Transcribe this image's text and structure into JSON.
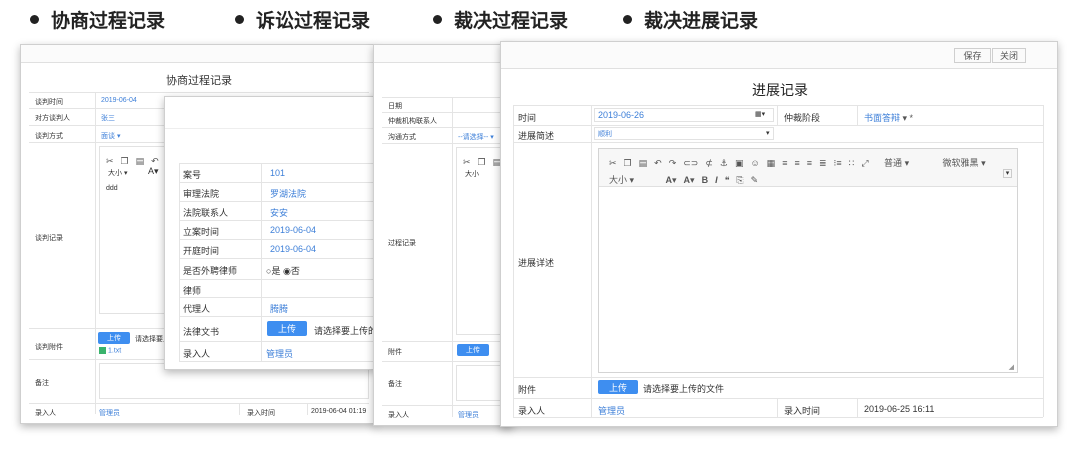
{
  "headings": [
    "协商过程记录",
    "诉讼过程记录",
    "裁决过程记录",
    "裁决进展记录"
  ],
  "consult": {
    "title": "协商过程记录",
    "time_label": "谈判时间",
    "time_value": "2019-06-04",
    "opponent_label": "对方谈判人",
    "opponent_value": "张三",
    "method_label": "谈判方式",
    "method_value": "面谈",
    "record_label": "谈判记录",
    "record_text": "ddd",
    "font_size_label": "大小",
    "attach_label": "谈判附件",
    "upload_label": "上传",
    "upload_hint": "请选择要上",
    "file_name": "1.txt",
    "note_label": "备注",
    "recorder_label": "录入人",
    "recorder_value": "管理员",
    "rec_time_label": "录入时间",
    "rec_time_value": "2019-06-04 01:19"
  },
  "litigation": {
    "case_no_label": "案号",
    "case_no_value": "101",
    "court_label": "审理法院",
    "court_value": "罗湖法院",
    "contact_label": "法院联系人",
    "contact_value": "安安",
    "file_time_label": "立案时间",
    "file_time_value": "2019-06-04",
    "open_time_label": "开庭时间",
    "open_time_value": "2019-06-04",
    "lawyer_q_label": "是否外聘律师",
    "opt_yes": "是",
    "opt_no": "否",
    "lawyer_label": "律师",
    "lawyer_value": "",
    "agent_label": "代理人",
    "agent_value": "腾腾",
    "doc_label": "法律文书",
    "upload_label": "上传",
    "upload_hint": "请选择要上传的文",
    "recorder_label": "录入人",
    "recorder_value": "管理员"
  },
  "arbitration": {
    "date_label": "日期",
    "contact_label": "仲裁机构联系人",
    "comm_label": "沟通方式",
    "comm_value": "--请选择-- ▾",
    "font_size_label": "大小",
    "process_label": "过程记录",
    "attach_label": "附件",
    "upload_label": "上传",
    "note_label": "备注",
    "recorder_label": "录入人",
    "recorder_value": "管理员"
  },
  "progress": {
    "save_label": "保存",
    "close_label": "关闭",
    "title": "进展记录",
    "time_label": "时间",
    "time_value": "2019-06-26",
    "stage_label": "仲裁阶段",
    "stage_value": "书面答辩",
    "summary_label": "进展简述",
    "summary_value": "顺利",
    "detail_label": "进展详述",
    "toolbar_style": "普通",
    "toolbar_font": "微软雅黑",
    "font_size_label": "大小",
    "attach_label": "附件",
    "upload_label": "上传",
    "upload_hint": "请选择要上传的文件",
    "recorder_label": "录入人",
    "recorder_value": "管理员",
    "rec_time_label": "录入时间",
    "rec_time_value": "2019-06-25 16:11"
  }
}
